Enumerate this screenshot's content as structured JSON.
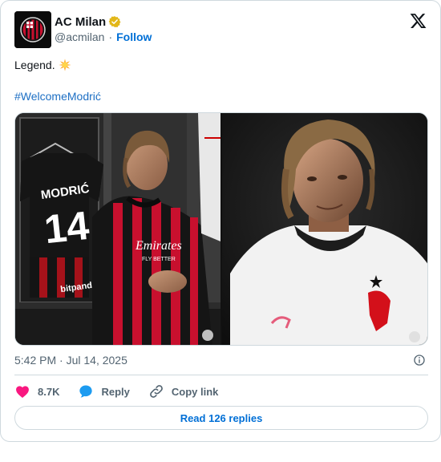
{
  "author": {
    "display_name": "AC Milan",
    "handle": "@acmilan",
    "separator": "·",
    "follow_label": "Follow",
    "avatar_icon": "ac-milan-crest",
    "verified_icon": "gold-verified-badge",
    "verified_color": "#e2b719"
  },
  "tweet": {
    "text": "Legend.",
    "emoji_icon": "glowing-star-emoji",
    "hashtag": "#WelcomeModrić",
    "timestamp": "5:42 PM · Jul 14, 2025"
  },
  "media": {
    "left_photo": {
      "jersey_name": "MODRIĆ",
      "jersey_number": "14",
      "sponsor_text": "Emirates",
      "sponsor_sub": "FLY BETTER",
      "sleeve_sponsor": "bitpanda"
    },
    "right_photo": {}
  },
  "actions": {
    "like_count": "8.7K",
    "reply_label": "Reply",
    "copy_label": "Copy link",
    "read_replies_label": "Read 126 replies"
  },
  "colors": {
    "link": "#006fd6",
    "like": "#f91880",
    "reply": "#1d9bf0",
    "text_secondary": "#536471",
    "border": "#cfd9de"
  }
}
